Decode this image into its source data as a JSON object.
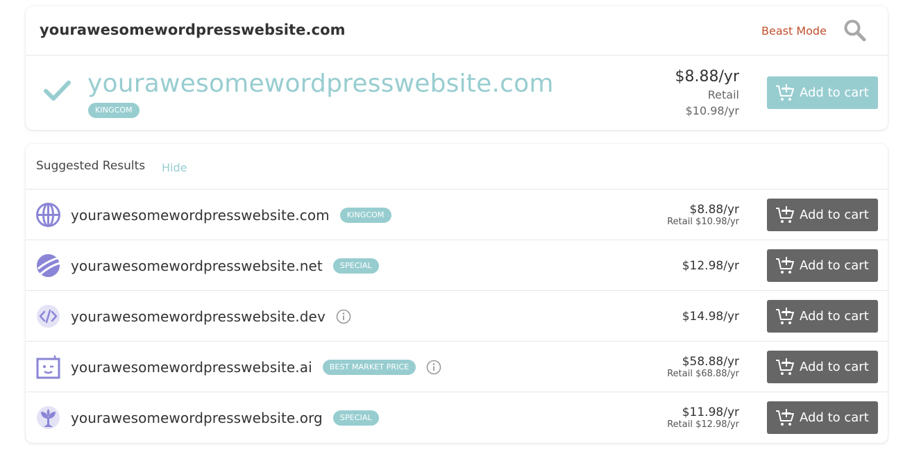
{
  "search": {
    "query": "yourawesomewordpresswebsite.com",
    "beast_mode_label": "Beast Mode"
  },
  "featured": {
    "domain": "yourawesomewordpresswebsite.com",
    "badge": "KINGCOM",
    "price": "$8.88/yr",
    "retail_label": "Retail",
    "retail_price": "$10.98/yr",
    "cart_label": "Add to cart"
  },
  "suggested": {
    "title": "Suggested Results",
    "hide_label": "Hide",
    "rows": [
      {
        "domain": "yourawesomewordpresswebsite.com",
        "badge": "KINGCOM",
        "price": "$8.88/yr",
        "retail": "Retail $10.98/yr",
        "cart_label": "Add to cart",
        "icon": "globe-icon"
      },
      {
        "domain": "yourawesomewordpresswebsite.net",
        "badge": "SPECIAL",
        "price": "$12.98/yr",
        "retail": "",
        "cart_label": "Add to cart",
        "icon": "net-swoosh-icon"
      },
      {
        "domain": "yourawesomewordpresswebsite.dev",
        "badge": "",
        "price": "$14.98/yr",
        "retail": "",
        "cart_label": "Add to cart",
        "icon": "code-icon"
      },
      {
        "domain": "yourawesomewordpresswebsite.ai",
        "badge": "BEST MARKET PRICE",
        "price": "$58.88/yr",
        "retail": "Retail $68.88/yr",
        "cart_label": "Add to cart",
        "icon": "robot-icon"
      },
      {
        "domain": "yourawesomewordpresswebsite.org",
        "badge": "SPECIAL",
        "price": "$11.98/yr",
        "retail": "Retail $12.98/yr",
        "cart_label": "Add to cart",
        "icon": "sprout-icon"
      }
    ]
  },
  "colors": {
    "accent_teal": "#98cdd0",
    "beast_mode_red": "#c0502d",
    "cart_gray": "#666666",
    "tld_icon_purple": "#8a85d6"
  }
}
